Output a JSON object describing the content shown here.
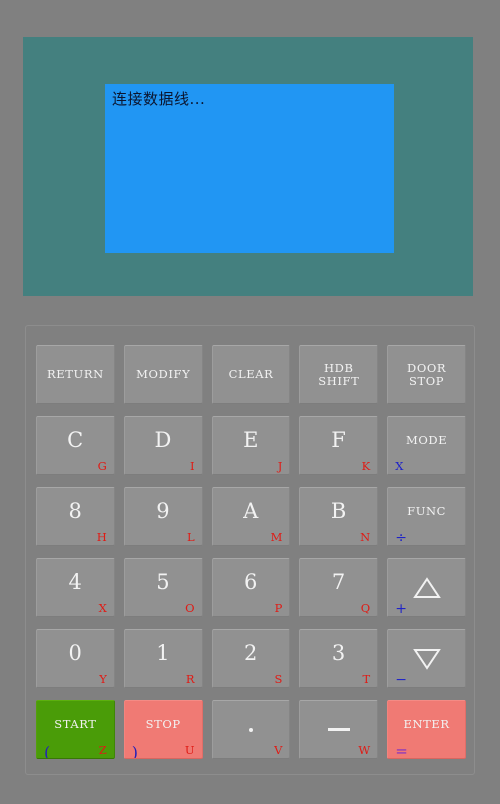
{
  "device": {
    "background_color": "#808080",
    "panel_color": "#44807f",
    "screen_color": "#2196f3"
  },
  "display": {
    "message": "连接数据线..."
  },
  "keypad": {
    "rows": [
      {
        "keys": [
          {
            "id": "return",
            "label": "RETURN",
            "label2": "",
            "style": "word",
            "alt": "",
            "alt_pos": ""
          },
          {
            "id": "modify",
            "label": "MODIFY",
            "label2": "",
            "style": "word",
            "alt": "",
            "alt_pos": ""
          },
          {
            "id": "clear",
            "label": "CLEAR",
            "label2": "",
            "style": "word",
            "alt": "",
            "alt_pos": ""
          },
          {
            "id": "hdb-shift",
            "label": "HDB",
            "label2": "SHIFT",
            "style": "word2",
            "alt": "",
            "alt_pos": ""
          },
          {
            "id": "door-stop",
            "label": "DOOR",
            "label2": "STOP",
            "style": "word2",
            "alt": "",
            "alt_pos": ""
          }
        ]
      },
      {
        "keys": [
          {
            "id": "c",
            "label": "C",
            "label2": "",
            "style": "big",
            "alt": "G",
            "alt_pos": "right"
          },
          {
            "id": "d",
            "label": "D",
            "label2": "",
            "style": "big",
            "alt": "I",
            "alt_pos": "right"
          },
          {
            "id": "e",
            "label": "E",
            "label2": "",
            "style": "big",
            "alt": "J",
            "alt_pos": "right"
          },
          {
            "id": "f",
            "label": "F",
            "label2": "",
            "style": "big",
            "alt": "K",
            "alt_pos": "right"
          },
          {
            "id": "mode",
            "label": "MODE",
            "label2": "",
            "style": "word",
            "alt": "X",
            "alt_pos": "left"
          }
        ]
      },
      {
        "keys": [
          {
            "id": "8",
            "label": "8",
            "label2": "",
            "style": "big",
            "alt": "H",
            "alt_pos": "right"
          },
          {
            "id": "9",
            "label": "9",
            "label2": "",
            "style": "big",
            "alt": "L",
            "alt_pos": "right"
          },
          {
            "id": "a",
            "label": "A",
            "label2": "",
            "style": "big",
            "alt": "M",
            "alt_pos": "right"
          },
          {
            "id": "b",
            "label": "B",
            "label2": "",
            "style": "big",
            "alt": "N",
            "alt_pos": "right"
          },
          {
            "id": "func",
            "label": "FUNC",
            "label2": "",
            "style": "word",
            "alt": "÷",
            "alt_pos": "left"
          }
        ]
      },
      {
        "keys": [
          {
            "id": "4",
            "label": "4",
            "label2": "",
            "style": "big",
            "alt": "X",
            "alt_pos": "right"
          },
          {
            "id": "5",
            "label": "5",
            "label2": "",
            "style": "big",
            "alt": "O",
            "alt_pos": "right"
          },
          {
            "id": "6",
            "label": "6",
            "label2": "",
            "style": "big",
            "alt": "P",
            "alt_pos": "right"
          },
          {
            "id": "7",
            "label": "7",
            "label2": "",
            "style": "big",
            "alt": "Q",
            "alt_pos": "right"
          },
          {
            "id": "up",
            "label": "△",
            "label2": "",
            "style": "glyph-triangle-up",
            "alt": "+",
            "alt_pos": "left"
          }
        ]
      },
      {
        "keys": [
          {
            "id": "0",
            "label": "0",
            "label2": "",
            "style": "big",
            "alt": "Y",
            "alt_pos": "right"
          },
          {
            "id": "1",
            "label": "1",
            "label2": "",
            "style": "big",
            "alt": "R",
            "alt_pos": "right"
          },
          {
            "id": "2",
            "label": "2",
            "label2": "",
            "style": "big",
            "alt": "S",
            "alt_pos": "right"
          },
          {
            "id": "3",
            "label": "3",
            "label2": "",
            "style": "big",
            "alt": "T",
            "alt_pos": "right"
          },
          {
            "id": "down",
            "label": "▽",
            "label2": "",
            "style": "glyph-triangle-down",
            "alt": "−",
            "alt_pos": "left"
          }
        ]
      },
      {
        "keys": [
          {
            "id": "start",
            "label": "START",
            "label2": "",
            "style": "word",
            "alt": "Z",
            "alt_pos": "right",
            "alt2": "(",
            "alt2_pos": "left",
            "color": "green"
          },
          {
            "id": "stop",
            "label": "STOP",
            "label2": "",
            "style": "word",
            "alt": "U",
            "alt_pos": "right",
            "alt2": ")",
            "alt2_pos": "left",
            "color": "red"
          },
          {
            "id": "dot",
            "label": "·",
            "label2": "",
            "style": "glyph-dot",
            "alt": "V",
            "alt_pos": "right"
          },
          {
            "id": "dash",
            "label": "—",
            "label2": "",
            "style": "glyph-dash",
            "alt": "W",
            "alt_pos": "right"
          },
          {
            "id": "enter",
            "label": "ENTER",
            "label2": "",
            "style": "word",
            "alt": "=",
            "alt_pos": "left-eq",
            "color": "red"
          }
        ]
      }
    ]
  },
  "colors": {
    "key_face": "#919191",
    "key_text": "#f2f2f2",
    "alt_red": "#e01b15",
    "alt_blue": "#1f23c8",
    "alt_purple": "#7b2fc8",
    "start_green": "#4a9c08",
    "stop_red": "#f07a74"
  }
}
